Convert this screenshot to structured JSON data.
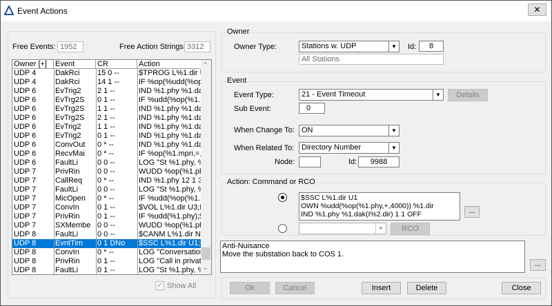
{
  "window": {
    "title": "Event Actions",
    "close": "✕"
  },
  "left": {
    "free_events_label": "Free Events:",
    "free_events": "1952",
    "free_actions_label": "Free Action Strings:",
    "free_actions": "3312",
    "show_all": "Show All",
    "show_all_checked": true
  },
  "table": {
    "headers": [
      "Owner [+]",
      "Event",
      "CR",
      "Action"
    ],
    "rows": [
      [
        "UDP 4",
        "DakRci",
        "15 0 --",
        "$TPROG L%1.dir U"
      ],
      [
        "UDP 4",
        "DakRci",
        "14 1 --",
        "IF %op(%udd(%op(:"
      ],
      [
        "UDP 6",
        "EvTrig2",
        "2 1 --",
        "IND %1.phy %1.da"
      ],
      [
        "UDP 6",
        "EvTrg2S",
        "0 1 --",
        "IF %udd(%op(%1.pl"
      ],
      [
        "UDP 6",
        "EvTrg2S",
        "1 1 --",
        "IND %1.phy %1.da"
      ],
      [
        "UDP 6",
        "EvTrg2S",
        "2 1 --",
        "IND %1.phy %1.da"
      ],
      [
        "UDP 6",
        "EvTrig2",
        "1 1 --",
        "IND %1.phy %1.da"
      ],
      [
        "UDP 6",
        "EvTrig2",
        "0 1 --",
        "IND %1.phy %1.da"
      ],
      [
        "UDP 6",
        "ConvOut",
        "0 * --",
        "IND %1.phy %1.da"
      ],
      [
        "UDP 6",
        "RecvMai",
        "0 * --",
        "IF %op(%1.mpri,=,4"
      ],
      [
        "UDP 6",
        "FaultLi",
        "0 0 --",
        "LOG \"St %1.phy, %"
      ],
      [
        "UDP 7",
        "PrivRin",
        "0 0 --",
        "WUDD %op(%1.ph"
      ],
      [
        "UDP 7",
        "CallReq",
        "0 * --",
        "IND %1.phy 12 1 3"
      ],
      [
        "UDP 7",
        "FaultLi",
        "0 0 --",
        "LOG \"St %1.phy, %"
      ],
      [
        "UDP 7",
        "MicOpen",
        "0 * --",
        "IF %udd(%op(%1.pl"
      ],
      [
        "UDP 7",
        "ConvIn",
        "0 1 --",
        "$VOL L%1.dir U3;II"
      ],
      [
        "UDP 7",
        "PrivRin",
        "0 1 --",
        "IF %udd(%1.phy);$I"
      ],
      [
        "UDP 7",
        "SXMembe",
        "0 0 --",
        "WUDD %op(%1.ph"
      ],
      [
        "UDP 8",
        "FaultLi",
        "0 0 --",
        "$CANM L%1.dir NC"
      ],
      [
        "UDP 8",
        "EvntTim",
        "0 1 DNo",
        "$SSC L%1.dir U1;0"
      ],
      [
        "UDP 8",
        "ConvIn",
        "0 * --",
        "LOG \"Conversation"
      ],
      [
        "UDP 8",
        "PrivRin",
        "0 1 --",
        "LOG \"Call in private"
      ],
      [
        "UDP 8",
        "FaultLi",
        "0 1 --",
        "LOG \"St %1.phy, %"
      ]
    ],
    "selected_index": 19
  },
  "owner": {
    "group": "Owner",
    "type_label": "Owner Type:",
    "type": "Stations w. UDP",
    "id_label": "Id:",
    "id": "8",
    "desc": "All Stations"
  },
  "event": {
    "group": "Event",
    "type_label": "Event Type:",
    "type": "21 - Event Timeout",
    "details": "Details",
    "sub_label": "Sub Event:",
    "sub": "0",
    "change_label": "When Change To:",
    "change": "ON",
    "related_label": "When Related To:",
    "related": "Directory Number",
    "node_label": "Node:",
    "node": "",
    "id_label": "Id:",
    "id": "9988"
  },
  "action": {
    "group": "Action: Command or RCO",
    "command": "$SSC L%1.dir U1\nOWN %udd(%op(%1.phy,+,4000)) %1.dir\nIND %1.phy %1.dak(I%2.dir) 1 1 OFF",
    "command_selected": true,
    "more": "...",
    "rco_value": "",
    "rco": "RCO"
  },
  "comment": {
    "text": "Anti-Nuisance\nMove the substation back to COS 1.",
    "more": "..."
  },
  "buttons": {
    "ok": "Ok",
    "cancel": "Cancel",
    "insert": "Insert",
    "delete": "Delete",
    "close": "Close"
  },
  "colors": {
    "selection": "#0078d7"
  }
}
